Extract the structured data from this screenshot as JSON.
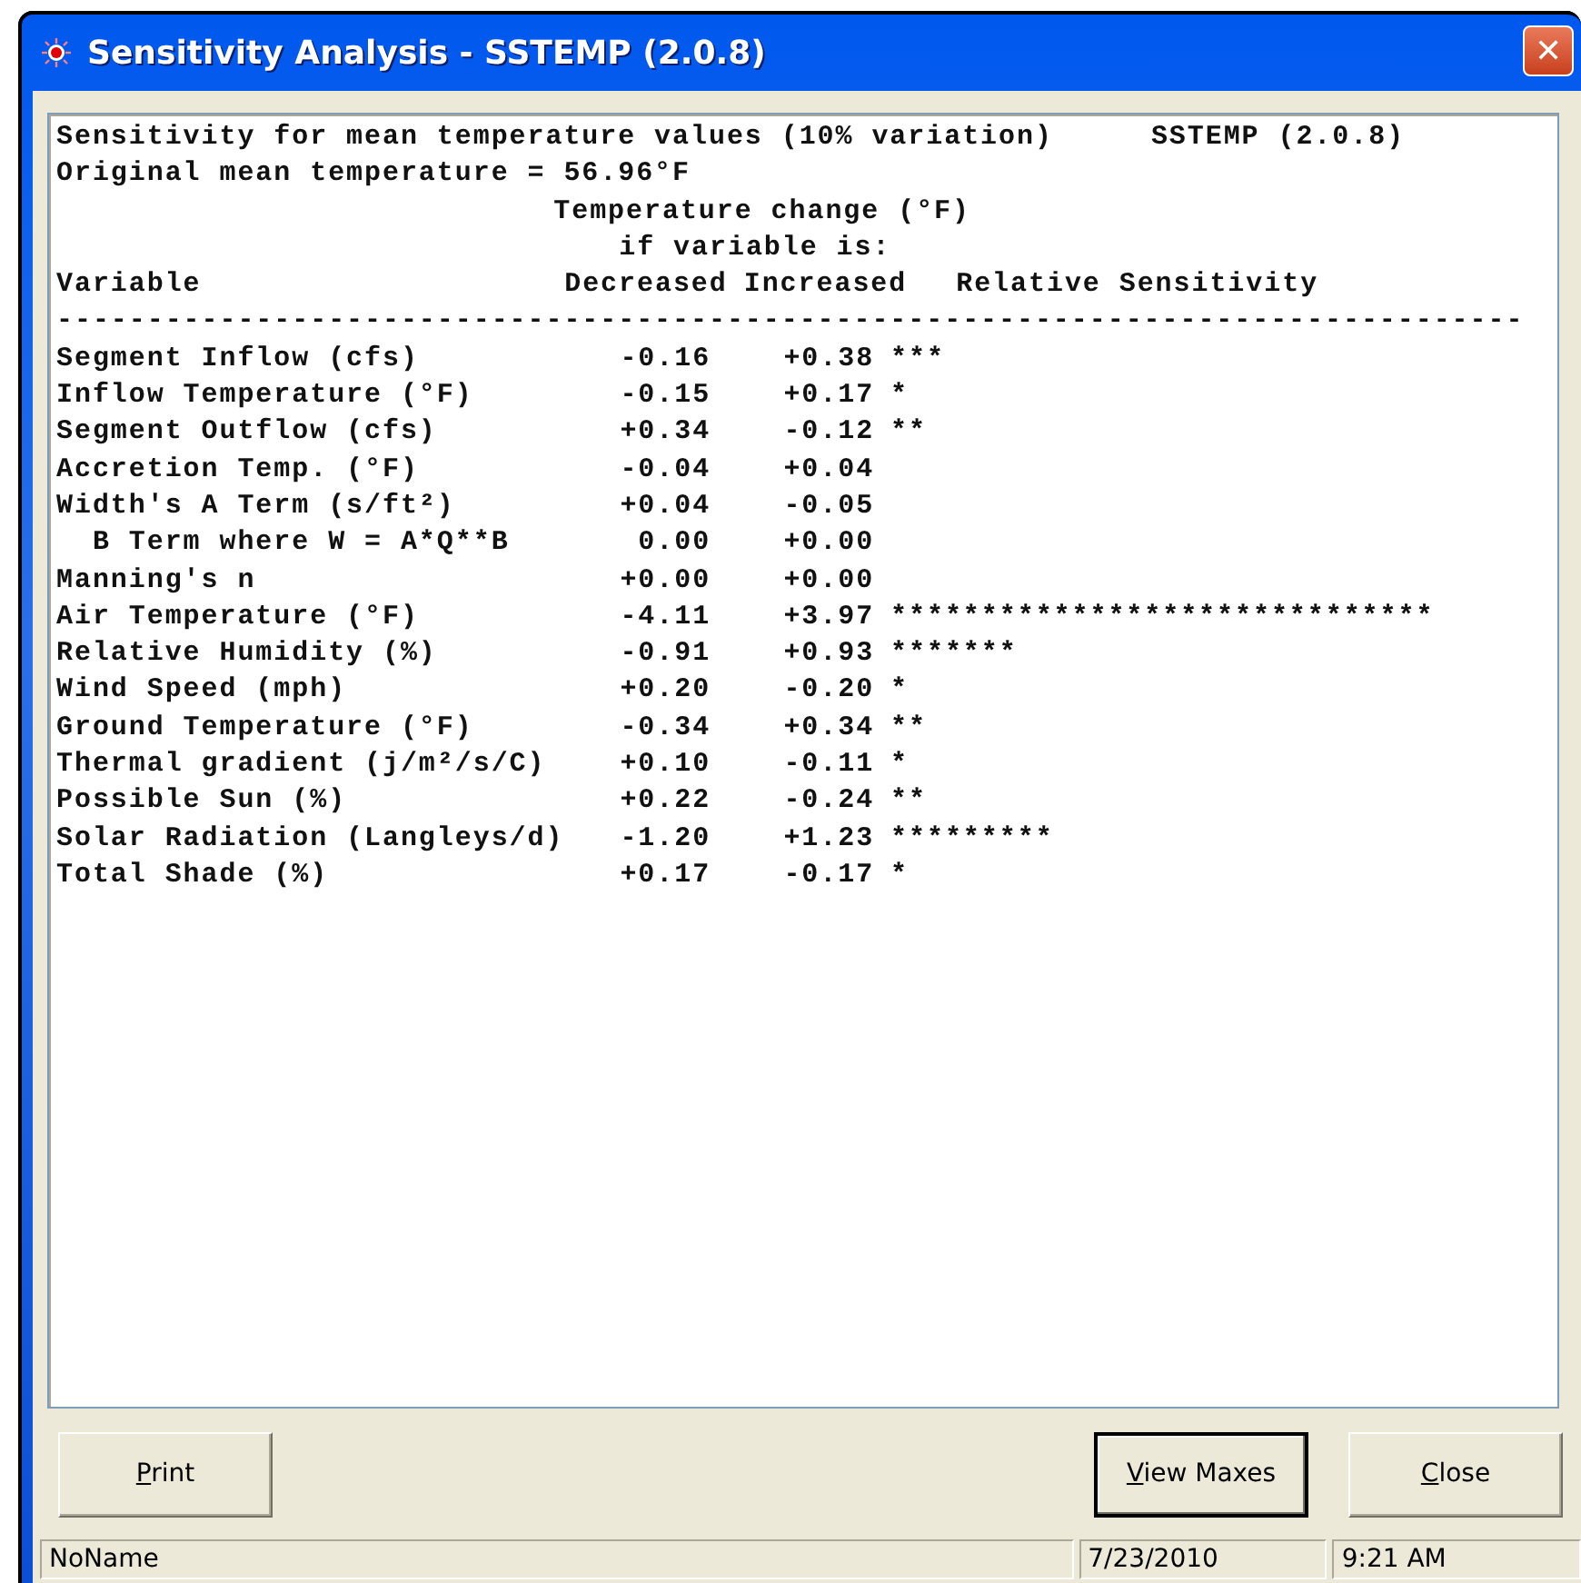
{
  "window": {
    "title": "Sensitivity Analysis - SSTEMP (2.0.8)",
    "close_glyph": "✕"
  },
  "report": {
    "heading": "Sensitivity for mean temperature values (10% variation)",
    "program": "SSTEMP (2.0.8)",
    "original": "Original mean temperature = 56.96°F",
    "header_lines": [
      "Temperature change (°F)",
      "if variable is:"
    ],
    "columns": [
      "Variable",
      "Decreased",
      "Increased",
      "Relative Sensitivity"
    ],
    "rule": "---------------------------------------------------------------------------------",
    "rows": [
      {
        "variable": "Segment Inflow (cfs)",
        "decreased": "-0.16",
        "increased": "+0.38",
        "sensitivity": "***"
      },
      {
        "variable": "Inflow Temperature (°F)",
        "decreased": "-0.15",
        "increased": "+0.17",
        "sensitivity": "*"
      },
      {
        "variable": "Segment Outflow (cfs)",
        "decreased": "+0.34",
        "increased": "-0.12",
        "sensitivity": "**"
      },
      {
        "variable": "Accretion Temp. (°F)",
        "decreased": "-0.04",
        "increased": "+0.04"
      },
      {
        "variable": "Width's A Term (s/ft²)",
        "decreased": "+0.04",
        "increased": "-0.05"
      },
      {
        "variable": "  B Term where W = A*Q**B",
        "decreased": "0.00",
        "increased": "+0.00"
      },
      {
        "variable": "Manning's n",
        "decreased": "+0.00",
        "increased": "+0.00"
      },
      {
        "variable": "Air Temperature (°F)",
        "decreased": "-4.11",
        "increased": "+3.97",
        "sensitivity": "******************************"
      },
      {
        "variable": "Relative Humidity (%)",
        "decreased": "-0.91",
        "increased": "+0.93",
        "sensitivity": "*******"
      },
      {
        "variable": "Wind Speed (mph)",
        "decreased": "+0.20",
        "increased": "-0.20",
        "sensitivity": "*"
      },
      {
        "variable": "Ground Temperature (°F)",
        "decreased": "-0.34",
        "increased": "+0.34",
        "sensitivity": "**"
      },
      {
        "variable": "Thermal gradient (j/m²/s/C)",
        "decreased": "+0.10",
        "increased": "-0.11",
        "sensitivity": "*"
      },
      {
        "variable": "Possible Sun (%)",
        "decreased": "+0.22",
        "increased": "-0.24",
        "sensitivity": "**"
      },
      {
        "variable": "Solar Radiation (Langleys/d)",
        "decreased": "-1.20",
        "increased": "+1.23",
        "sensitivity": "*********"
      },
      {
        "variable": "Total Shade (%)",
        "decreased": "+0.17",
        "increased": "-0.17",
        "sensitivity": "*"
      }
    ]
  },
  "buttons": [
    {
      "label": {
        "key": "P",
        "after": "rint"
      },
      "default": false
    },
    {
      "label": {
        "key": "V",
        "after": "iew Maxes"
      },
      "default": true
    },
    {
      "label": {
        "key": "C",
        "after": "lose"
      },
      "default": false
    }
  ],
  "status_bar": [
    "NoName",
    "7/23/2010",
    "9:21 AM"
  ]
}
